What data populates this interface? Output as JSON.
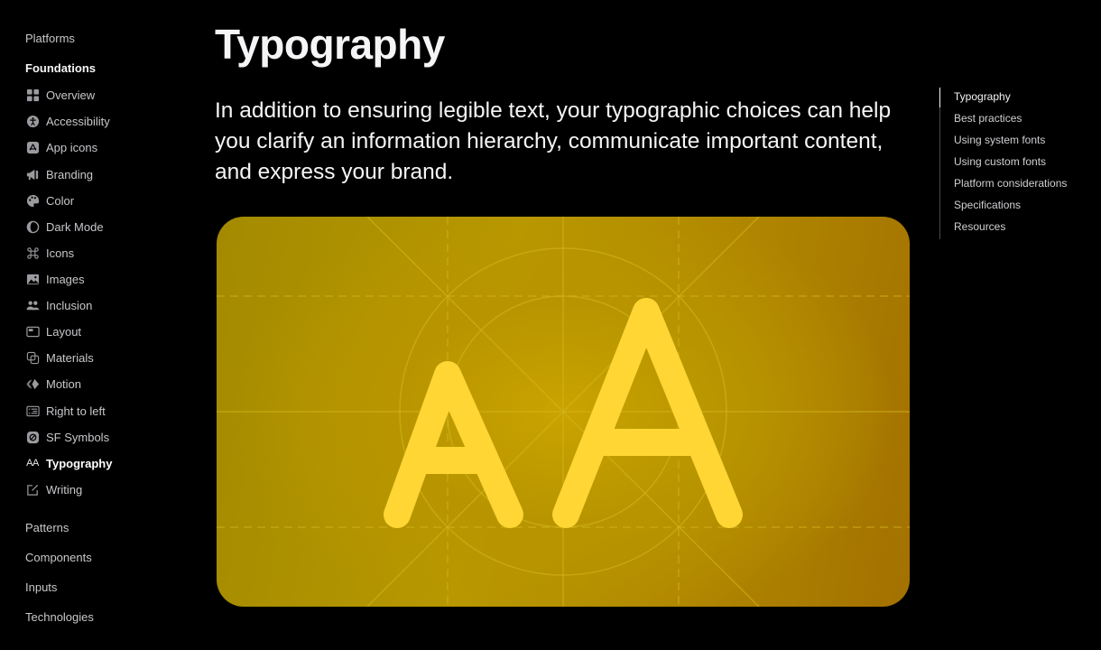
{
  "sidebar": {
    "platforms": "Platforms",
    "foundations": "Foundations",
    "items": [
      {
        "label": "Overview",
        "icon": "grid-icon"
      },
      {
        "label": "Accessibility",
        "icon": "accessibility-icon"
      },
      {
        "label": "App icons",
        "icon": "app-store-icon"
      },
      {
        "label": "Branding",
        "icon": "megaphone-icon"
      },
      {
        "label": "Color",
        "icon": "palette-icon"
      },
      {
        "label": "Dark Mode",
        "icon": "circle-half-icon"
      },
      {
        "label": "Icons",
        "icon": "command-icon"
      },
      {
        "label": "Images",
        "icon": "photo-icon"
      },
      {
        "label": "Inclusion",
        "icon": "people-icon"
      },
      {
        "label": "Layout",
        "icon": "layout-icon"
      },
      {
        "label": "Materials",
        "icon": "materials-icon"
      },
      {
        "label": "Motion",
        "icon": "motion-icon"
      },
      {
        "label": "Right to left",
        "icon": "right-to-left-icon"
      },
      {
        "label": "SF Symbols",
        "icon": "sf-symbols-icon"
      },
      {
        "label": "Typography",
        "icon": "typography-icon",
        "icon_text": "AA",
        "active": true
      },
      {
        "label": "Writing",
        "icon": "compose-icon"
      }
    ],
    "patterns": "Patterns",
    "components": "Components",
    "inputs": "Inputs",
    "technologies": "Technologies"
  },
  "main": {
    "title": "Typography",
    "lede": "In addition to ensuring legible text, your typographic choices can help you clarify an information hierarchy, communicate important content, and express your brand.",
    "hero": {
      "letters": [
        "A",
        "A"
      ],
      "colors": {
        "glyph": "#ffd633",
        "background": "#b89500",
        "grid": "#d4b21a"
      }
    }
  },
  "toc": {
    "items": [
      {
        "label": "Typography",
        "active": true
      },
      {
        "label": "Best practices"
      },
      {
        "label": "Using system fonts"
      },
      {
        "label": "Using custom fonts"
      },
      {
        "label": "Platform considerations"
      },
      {
        "label": "Specifications"
      },
      {
        "label": "Resources"
      }
    ]
  }
}
